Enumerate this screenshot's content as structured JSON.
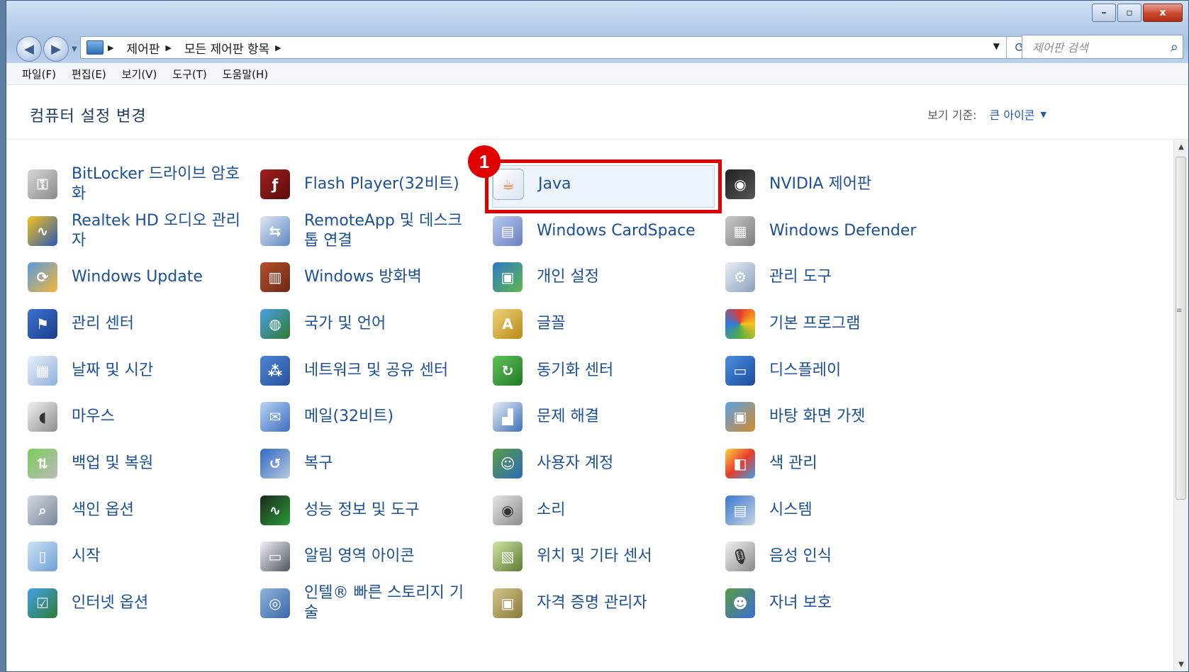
{
  "window": {
    "caption_buttons": {
      "minimize": "–",
      "maximize": "▫",
      "close": "x"
    }
  },
  "address": {
    "breadcrumbs": [
      "제어판",
      "모든 제어판 항목"
    ],
    "search_placeholder": "제어판 검색"
  },
  "menu": [
    "파일(F)",
    "편집(E)",
    "보기(V)",
    "도구(T)",
    "도움말(H)"
  ],
  "header": {
    "title": "컴퓨터 설정 변경",
    "view_by_label": "보기 기준:",
    "view_by_value": "큰 아이콘"
  },
  "annotation": {
    "badge": "1",
    "highlight_color": "#e00000"
  },
  "items": [
    {
      "label": "BitLocker 드라이브 암호화",
      "icon": "key-icon"
    },
    {
      "label": "Flash Player(32비트)",
      "icon": "flash-icon"
    },
    {
      "label": "Java",
      "icon": "java-icon"
    },
    {
      "label": "NVIDIA 제어판",
      "icon": "nvidia-icon"
    },
    {
      "label": "Realtek HD 오디오 관리자",
      "icon": "audio-icon"
    },
    {
      "label": "RemoteApp 및 데스크톱 연결",
      "icon": "remote-icon"
    },
    {
      "label": "Windows CardSpace",
      "icon": "cardspace-icon"
    },
    {
      "label": "Windows Defender",
      "icon": "defender-icon"
    },
    {
      "label": "Windows Update",
      "icon": "update-icon"
    },
    {
      "label": "Windows 방화벽",
      "icon": "firewall-icon"
    },
    {
      "label": "개인 설정",
      "icon": "personalize-icon"
    },
    {
      "label": "관리 도구",
      "icon": "admin-tools-icon"
    },
    {
      "label": "관리 센터",
      "icon": "flag-icon"
    },
    {
      "label": "국가 및 언어",
      "icon": "globe-clock-icon"
    },
    {
      "label": "글꼴",
      "icon": "font-icon"
    },
    {
      "label": "기본 프로그램",
      "icon": "default-programs-icon"
    },
    {
      "label": "날짜 및 시간",
      "icon": "calendar-icon"
    },
    {
      "label": "네트워크 및 공유 센터",
      "icon": "network-icon"
    },
    {
      "label": "동기화 센터",
      "icon": "sync-icon"
    },
    {
      "label": "디스플레이",
      "icon": "display-icon"
    },
    {
      "label": "마우스",
      "icon": "mouse-icon"
    },
    {
      "label": "메일(32비트)",
      "icon": "mail-icon"
    },
    {
      "label": "문제 해결",
      "icon": "troubleshoot-icon"
    },
    {
      "label": "바탕 화면 가젯",
      "icon": "gadgets-icon"
    },
    {
      "label": "백업 및 복원",
      "icon": "backup-icon"
    },
    {
      "label": "복구",
      "icon": "recovery-icon"
    },
    {
      "label": "사용자 계정",
      "icon": "users-icon"
    },
    {
      "label": "색 관리",
      "icon": "color-icon"
    },
    {
      "label": "색인 옵션",
      "icon": "index-icon"
    },
    {
      "label": "성능 정보 및 도구",
      "icon": "performance-icon"
    },
    {
      "label": "소리",
      "icon": "speaker-icon"
    },
    {
      "label": "시스템",
      "icon": "system-icon"
    },
    {
      "label": "시작",
      "icon": "getting-started-icon"
    },
    {
      "label": "알림 영역 아이콘",
      "icon": "notification-icon"
    },
    {
      "label": "위치 및 기타 센서",
      "icon": "sensor-icon"
    },
    {
      "label": "음성 인식",
      "icon": "microphone-icon"
    },
    {
      "label": "인터넷 옵션",
      "icon": "internet-icon"
    },
    {
      "label": "인텔® 빠른 스토리지 기술",
      "icon": "intel-storage-icon"
    },
    {
      "label": "자격 증명 관리자",
      "icon": "credential-icon"
    },
    {
      "label": "자녀 보호",
      "icon": "parental-icon"
    }
  ]
}
